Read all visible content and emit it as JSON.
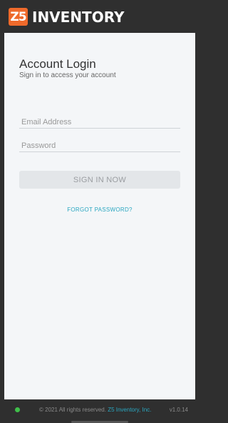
{
  "header": {
    "logo_mark": "Z5",
    "logo_text": "INVENTORY"
  },
  "login": {
    "title": "Account Login",
    "subtitle": "Sign in to access your account",
    "email_placeholder": "Email Address",
    "password_placeholder": "Password",
    "signin_label": "SIGN IN NOW",
    "forgot_label": "FORGOT PASSWORD?"
  },
  "footer": {
    "copyright_prefix": "© 2021 All rights reserved.",
    "company": "Z5 Inventory, Inc.",
    "version": "v1.0.14",
    "status_color": "#3fbf4a"
  },
  "colors": {
    "brand": "#ef6a2b",
    "link": "#2aa7c1",
    "background": "#2f2f2f",
    "panel": "#f4f6f8"
  }
}
